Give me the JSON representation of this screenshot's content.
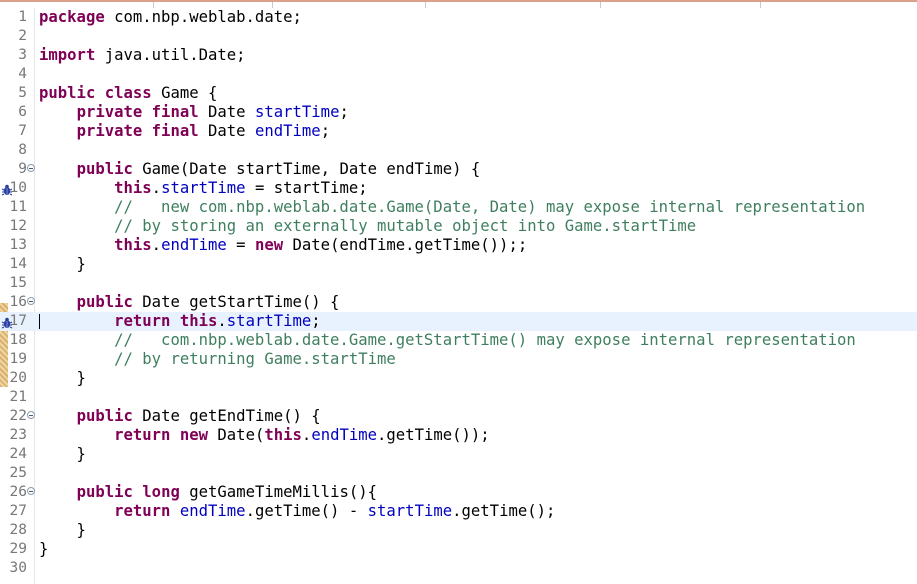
{
  "editor": {
    "lines": [
      {
        "num": "1",
        "tokens": [
          {
            "t": "package",
            "c": "kw"
          },
          {
            "t": " com.nbp.weblab.date;"
          }
        ]
      },
      {
        "num": "2",
        "tokens": []
      },
      {
        "num": "3",
        "tokens": [
          {
            "t": "import",
            "c": "kw"
          },
          {
            "t": " java.util.Date;"
          }
        ]
      },
      {
        "num": "4",
        "tokens": []
      },
      {
        "num": "5",
        "tokens": [
          {
            "t": "public",
            "c": "kw"
          },
          {
            "t": " "
          },
          {
            "t": "class",
            "c": "kw"
          },
          {
            "t": " Game {"
          }
        ]
      },
      {
        "num": "6",
        "tokens": [
          {
            "t": "    "
          },
          {
            "t": "private",
            "c": "kw"
          },
          {
            "t": " "
          },
          {
            "t": "final",
            "c": "kw"
          },
          {
            "t": " Date "
          },
          {
            "t": "startTime",
            "c": "field"
          },
          {
            "t": ";"
          }
        ]
      },
      {
        "num": "7",
        "tokens": [
          {
            "t": "    "
          },
          {
            "t": "private",
            "c": "kw"
          },
          {
            "t": " "
          },
          {
            "t": "final",
            "c": "kw"
          },
          {
            "t": " Date "
          },
          {
            "t": "endTime",
            "c": "field"
          },
          {
            "t": ";"
          }
        ]
      },
      {
        "num": "8",
        "tokens": []
      },
      {
        "num": "9",
        "fold": true,
        "tokens": [
          {
            "t": "    "
          },
          {
            "t": "public",
            "c": "kw"
          },
          {
            "t": " Game(Date startTime, Date endTime) {"
          }
        ]
      },
      {
        "num": "10",
        "bug": true,
        "tokens": [
          {
            "t": "        "
          },
          {
            "t": "this",
            "c": "kw"
          },
          {
            "t": "."
          },
          {
            "t": "startTime",
            "c": "field"
          },
          {
            "t": " = startTime;"
          }
        ]
      },
      {
        "num": "11",
        "tokens": [
          {
            "t": "        "
          },
          {
            "t": "//   new com.nbp.weblab.date.Game(Date, Date) may expose internal representation",
            "c": "cmt"
          }
        ]
      },
      {
        "num": "12",
        "tokens": [
          {
            "t": "        "
          },
          {
            "t": "// by storing an externally mutable object into Game.startTime",
            "c": "cmt"
          }
        ]
      },
      {
        "num": "13",
        "tokens": [
          {
            "t": "        "
          },
          {
            "t": "this",
            "c": "kw"
          },
          {
            "t": "."
          },
          {
            "t": "endTime",
            "c": "field"
          },
          {
            "t": " = "
          },
          {
            "t": "new",
            "c": "kw"
          },
          {
            "t": " Date(endTime.getTime());;"
          }
        ]
      },
      {
        "num": "14",
        "tokens": [
          {
            "t": "    }"
          }
        ]
      },
      {
        "num": "15",
        "tokens": []
      },
      {
        "num": "16",
        "fold": true,
        "tokens": [
          {
            "t": "    "
          },
          {
            "t": "public",
            "c": "kw"
          },
          {
            "t": " Date getStartTime() {"
          }
        ]
      },
      {
        "num": "17",
        "bug": true,
        "current": true,
        "tokens": [
          {
            "t": "        "
          },
          {
            "t": "return",
            "c": "kw"
          },
          {
            "t": " "
          },
          {
            "t": "this",
            "c": "kw"
          },
          {
            "t": "."
          },
          {
            "t": "startTime",
            "c": "field"
          },
          {
            "t": ";"
          }
        ]
      },
      {
        "num": "18",
        "tokens": [
          {
            "t": "        "
          },
          {
            "t": "//   com.nbp.weblab.date.Game.getStartTime() may expose internal representation",
            "c": "cmt"
          }
        ]
      },
      {
        "num": "19",
        "tokens": [
          {
            "t": "        "
          },
          {
            "t": "// by returning Game.startTime",
            "c": "cmt"
          }
        ]
      },
      {
        "num": "20",
        "tokens": [
          {
            "t": "    }"
          }
        ]
      },
      {
        "num": "21",
        "tokens": []
      },
      {
        "num": "22",
        "fold": true,
        "tokens": [
          {
            "t": "    "
          },
          {
            "t": "public",
            "c": "kw"
          },
          {
            "t": " Date getEndTime() {"
          }
        ]
      },
      {
        "num": "23",
        "tokens": [
          {
            "t": "        "
          },
          {
            "t": "return",
            "c": "kw"
          },
          {
            "t": " "
          },
          {
            "t": "new",
            "c": "kw"
          },
          {
            "t": " Date("
          },
          {
            "t": "this",
            "c": "kw"
          },
          {
            "t": "."
          },
          {
            "t": "endTime",
            "c": "field"
          },
          {
            "t": ".getTime());"
          }
        ]
      },
      {
        "num": "24",
        "tokens": [
          {
            "t": "    }"
          }
        ]
      },
      {
        "num": "25",
        "tokens": []
      },
      {
        "num": "26",
        "fold": true,
        "tokens": [
          {
            "t": "    "
          },
          {
            "t": "public",
            "c": "kw"
          },
          {
            "t": " "
          },
          {
            "t": "long",
            "c": "kw"
          },
          {
            "t": " getGameTimeMillis(){"
          }
        ]
      },
      {
        "num": "27",
        "tokens": [
          {
            "t": "        "
          },
          {
            "t": "return",
            "c": "kw"
          },
          {
            "t": " "
          },
          {
            "t": "endTime",
            "c": "field"
          },
          {
            "t": ".getTime() - "
          },
          {
            "t": "startTime",
            "c": "field"
          },
          {
            "t": ".getTime();"
          }
        ]
      },
      {
        "num": "28",
        "tokens": [
          {
            "t": "    }"
          }
        ]
      },
      {
        "num": "29",
        "tokens": [
          {
            "t": "}"
          }
        ]
      },
      {
        "num": "30",
        "tokens": []
      }
    ]
  },
  "colors": {
    "keyword": "#7f0055",
    "field": "#0000c0",
    "comment": "#3f7f5f",
    "current_line": "#e8f2fe",
    "warning_marker": "#d8b070"
  },
  "icons": {
    "fold": "collapse-circle-icon",
    "bug": "findbugs-bug-icon"
  }
}
